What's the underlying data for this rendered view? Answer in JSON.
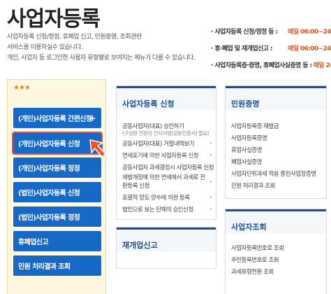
{
  "page": {
    "title": "사업자등록"
  },
  "description": {
    "line1": "사업자등록 신청/정정, 휴폐업 신고, 민원증명, 조회관련",
    "line2": "서비스를 이용하실수 있습니다.",
    "line3": "개인, 사업자 등 로그인한 사용자 유형별로 보여지는 메뉴가 다를 수 있습니다."
  },
  "hours": [
    {
      "label": "· 사업자등록 신청/정정 등 :",
      "time": "매일 06:00~24:00"
    },
    {
      "label": "· 휴·폐업 및 재개업신고 :",
      "time": "매일 06:00~24:00"
    },
    {
      "label": "· 사업자등록증·증명, 휴폐업사실증명 등 :",
      "time": "매일 24시간"
    }
  ],
  "left_menu": {
    "stars": "★★★",
    "items": [
      {
        "label": "(개인)사업자등록 간편신청",
        "plus": "+"
      },
      {
        "label": "(개인)사업자등록 신청"
      },
      {
        "label": "(개인)사업자등록 정정"
      },
      {
        "label": "(법인)사업자등록 신청"
      },
      {
        "label": "(법인)사업자등록 정정"
      },
      {
        "label": "휴폐업신고"
      },
      {
        "label": "민원 처리결과 조회"
      }
    ]
  },
  "col1": {
    "title": "사업자등록 신청",
    "items": [
      {
        "label": "공동사업자(대표) 승인하기"
      },
      {
        "label": "(구성원 전원의 전자서명(공동인증서) 필요)",
        "sub": true
      },
      {
        "label": "공동사업자(대표) 거절내역보기",
        "chev": "›"
      },
      {
        "label": "면세포기에 의한 사업자등록 신청",
        "chev": "›"
      },
      {
        "label": "공동사업자 과세결정시 사업자등록 신청",
        "chev": "›"
      },
      {
        "label": "세법개정에 의한 면세에서 과세로 전환등록 신청",
        "chev": "›",
        "two": true
      },
      {
        "label": "포괄적 양도·양수에 의한 등록",
        "chev": "›"
      },
      {
        "label": "법인으로 보는 단체의 승인신청",
        "chev": "›"
      }
    ],
    "next_title": "재개업신고"
  },
  "col2": {
    "title": "민원증명",
    "items": [
      {
        "label": "사업자등록증 재발급"
      },
      {
        "label": "사업자등록증명"
      },
      {
        "label": "휴업사실증명"
      },
      {
        "label": "폐업사실증명"
      },
      {
        "label": "사업자단위과세 적용 종된사업장증명"
      },
      {
        "label": "민원 처리결과 조회"
      }
    ],
    "next_title": "사업자조회",
    "next_items": [
      {
        "label": "사업자등록번호로 조회"
      },
      {
        "label": "주민등록번호로 조회"
      },
      {
        "label": "과세유형전환 조회"
      }
    ]
  }
}
